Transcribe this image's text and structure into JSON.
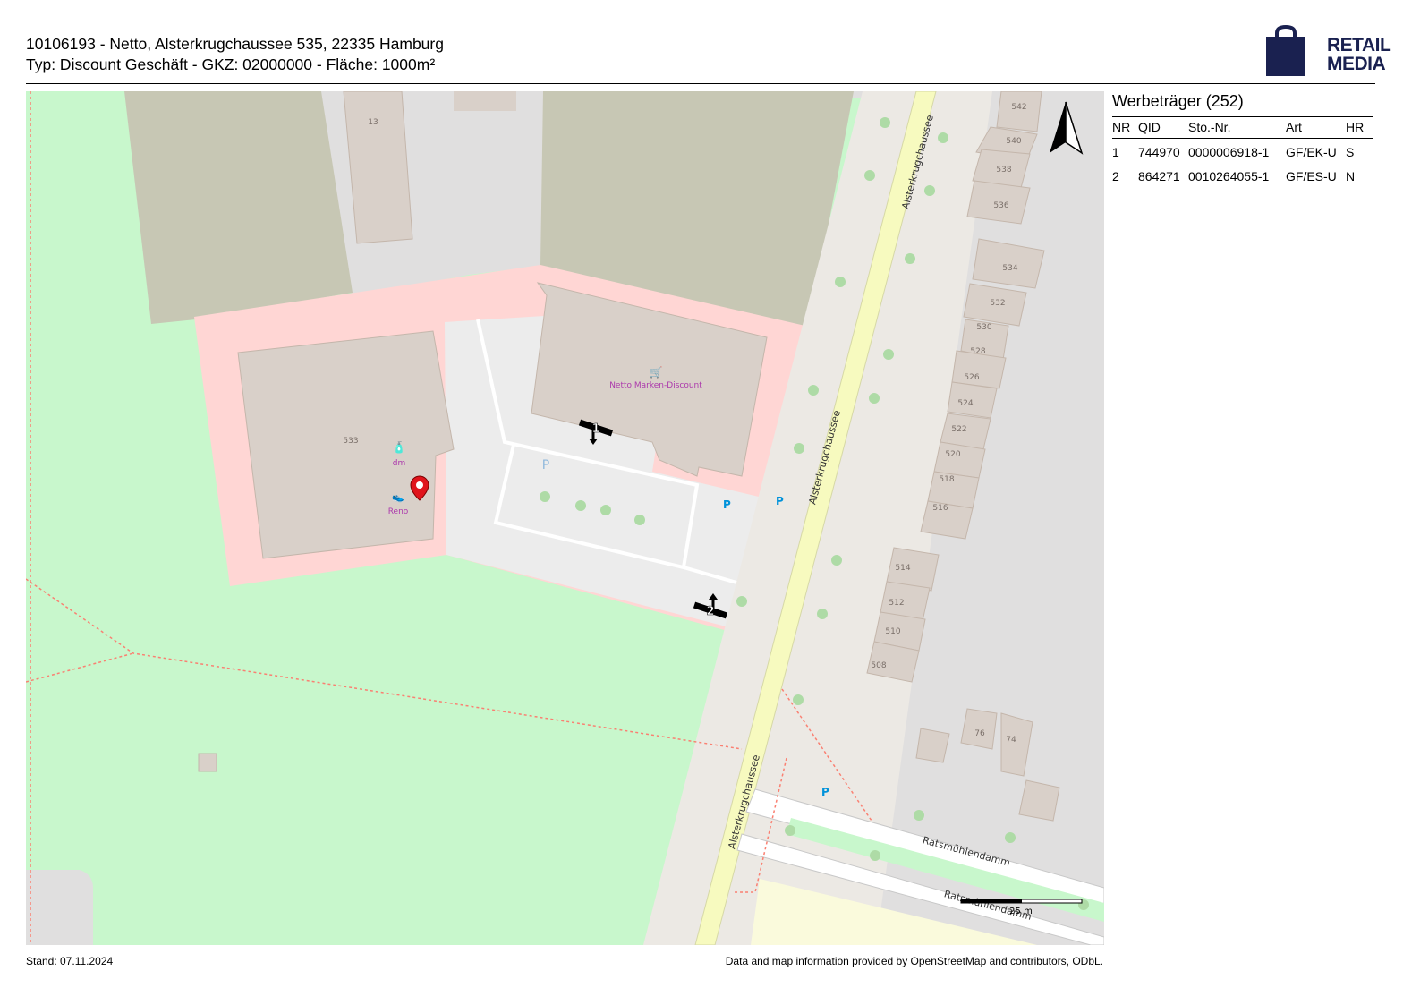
{
  "header": {
    "title_line1": "10106193 - Netto, Alsterkrugchaussee 535, 22335 Hamburg",
    "title_line2": "Typ: Discount Geschäft - GKZ: 02000000 - Fläche: 1000m²"
  },
  "logo": {
    "line1": "RETAIL",
    "line2": "MEDIA",
    "icon": "shopping-bag-icon",
    "color": "#1a2150"
  },
  "panel": {
    "title": "Werbeträger (252)",
    "columns": [
      "NR",
      "QID",
      "Sto.-Nr.",
      "Art",
      "HR"
    ],
    "rows": [
      {
        "nr": "1",
        "qid": "744970",
        "sto": "0000006918-1",
        "art": "GF/EK-U",
        "hr": "S"
      },
      {
        "nr": "2",
        "qid": "864271",
        "sto": "0010264055-1",
        "art": "GF/ES-U",
        "hr": "N"
      }
    ]
  },
  "map": {
    "street_labels": [
      "Alsterkrugchaussee",
      "Alsterkrugchaussee",
      "Alsterkrugchaussee",
      "Ratsmühlendamm",
      "Ratsmühlendamm"
    ],
    "poi_labels": [
      "Netto Marken-Discount",
      "dm",
      "Reno",
      "P"
    ],
    "house_numbers": [
      "13",
      "533",
      "542",
      "540",
      "538",
      "536",
      "534",
      "532",
      "530",
      "528",
      "526",
      "524",
      "522",
      "520",
      "518",
      "516",
      "514",
      "512",
      "510",
      "508",
      "76",
      "74"
    ],
    "markers": [
      "1",
      "2"
    ],
    "scale_label": "25 m",
    "north_arrow": "north-arrow-icon",
    "colors": {
      "retail": "#ffd6d4",
      "park": "#c8f7cc",
      "main_road": "#f7fabf",
      "building": "#d9d0c9",
      "tree": "#aedba6"
    }
  },
  "footer": {
    "date": "Stand: 07.11.2024",
    "attribution": "Data and map information provided by OpenStreetMap and contributors, ODbL."
  }
}
